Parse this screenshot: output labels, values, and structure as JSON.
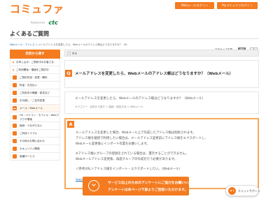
{
  "header": {
    "logo_text": "コミュファ",
    "logo_powered": "Powered by",
    "logo_ctc": "ctc",
    "buttons": [
      "Webメールログイン",
      "Myコミュファログイン"
    ]
  },
  "page": {
    "title": "よくあるご質問",
    "breadcrumb_link": "Webメール・アドレス",
    "breadcrumb_rest": " > メールアドレスを変更したら、Webメールのアドレス帳はどうなりますか？（W"
  },
  "font_size": {
    "label": "文字サイズ変更",
    "options": [
      "標準",
      "大"
    ]
  },
  "sidebar": {
    "header": "目的から探す",
    "items": [
      {
        "label": "お申し込み・ご契約中のお客さま",
        "kind": "bullet"
      },
      {
        "label": "ご利用開始・増速をご検討中",
        "kind": "bullet"
      },
      {
        "label": "ご契約内容・変更・解約",
        "kind": "icon"
      },
      {
        "label": "料金・お支払い",
        "kind": "icon"
      },
      {
        "label": "ご利用中の機器・設定など",
        "kind": "icon"
      },
      {
        "label": "お引越し・ご住所変更",
        "kind": "icon"
      },
      {
        "label": "メール・Webメール",
        "kind": "icon"
      },
      {
        "label": "OS・パソコン・モバイル・Webブラウザ環境",
        "kind": "icon-tall"
      },
      {
        "label": "接続・つながらない",
        "kind": "icon"
      },
      {
        "label": "ご利用トラブル",
        "kind": "icon"
      },
      {
        "label": "その他のお問い合わせ",
        "kind": "icon"
      },
      {
        "label": "セキュリティ関連",
        "kind": "icon"
      },
      {
        "label": "各種サービス",
        "kind": "icon"
      }
    ]
  },
  "main": {
    "back_label": "戻る",
    "q_mark": "Q",
    "question": "メールアドレスを変更したら、Webメールのアドレス帳はどうなりますか？（Webメール）",
    "question_detail": "メールアドレスを変更したら、Webメールのアドレス帳はどうなりますか？（Webメール）",
    "category": "カテゴリー：目的から探す > 接続・設定方法 > Webメール",
    "a_mark": "A",
    "answer_lines": [
      "メールアドレスを変更した場合、Webメール上で作成したアドレス帳は削除されます。",
      "アドレス帳を継続で利用したい場合は、メールアドレス変更前にアドレス帳をエクスポートし、",
      "Webメール変更後にインポート作業をお願いします。",
      "",
      "※アドレス帳にグループの登録をされている場合は、還元することができません。",
      "Webメールアドレス変更後、再度グループの作成を行う必要があります。",
      "",
      "＜参考URL＞アドレス帳をインポート・エクスポートしたい。（Webメール）"
    ],
    "answer_link": "https://faq.commufa.jp/faq/show/1042?site_domain=default"
  },
  "survey": {
    "line1": "サービス向上のためのアンケートにご協力をお願いいたします。",
    "line2": "アンケートは本ページ下部よりご回答いただけます。"
  },
  "chat": {
    "label": "チャットサポート"
  },
  "colors": {
    "brand": "#f47b20",
    "link": "#1a6fb5",
    "ctc_green": "#0a7a3a"
  }
}
